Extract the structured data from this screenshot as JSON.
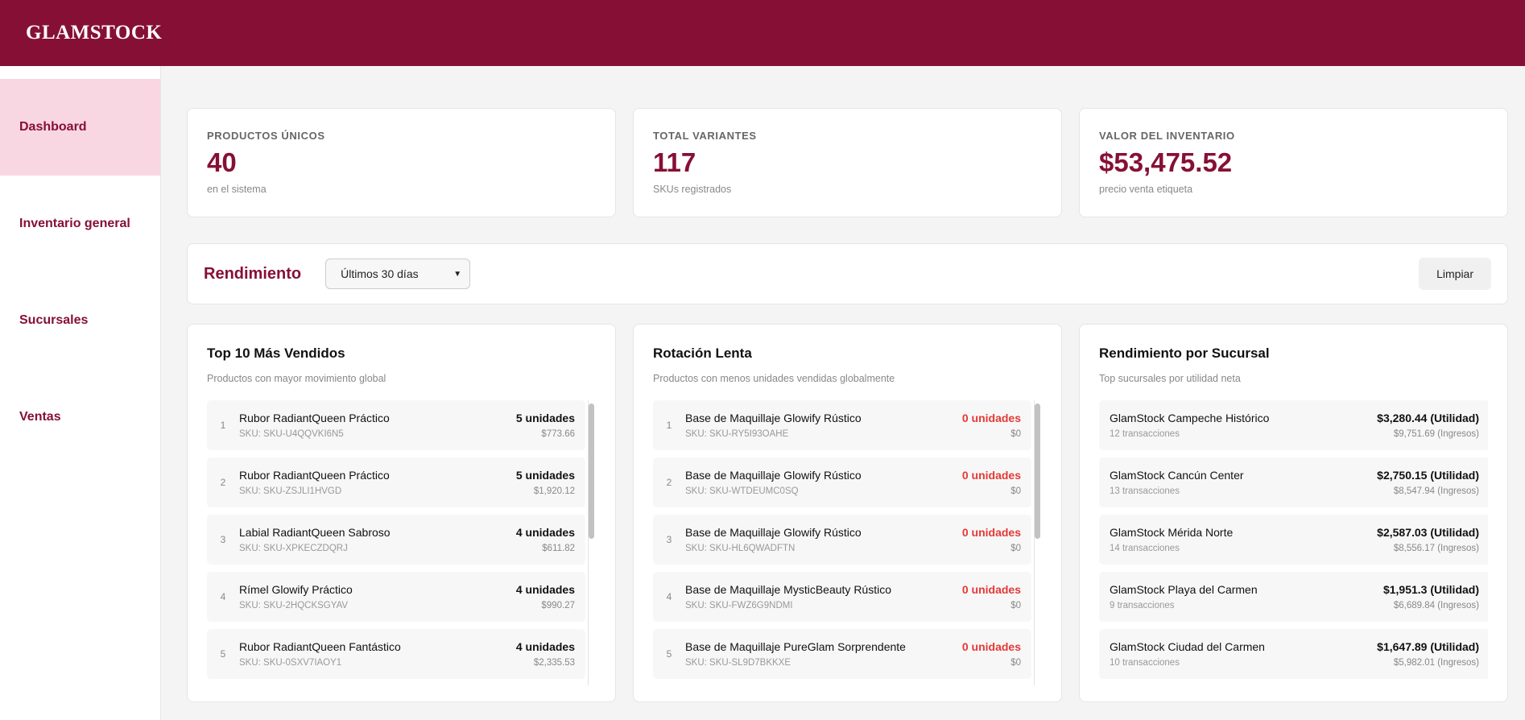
{
  "app": {
    "brand": "GLAMSTOCK"
  },
  "sidebar": {
    "items": [
      {
        "label": "Dashboard",
        "active": true
      },
      {
        "label": "Inventario general"
      },
      {
        "label": "Sucursales"
      },
      {
        "label": "Ventas"
      }
    ]
  },
  "stats": [
    {
      "label": "PRODUCTOS ÚNICOS",
      "value": "40",
      "sub": "en el sistema"
    },
    {
      "label": "TOTAL VARIANTES",
      "value": "117",
      "sub": "SKUs registrados"
    },
    {
      "label": "VALOR DEL INVENTARIO",
      "value": "$53,475.52",
      "sub": "precio venta etiqueta"
    }
  ],
  "performance": {
    "title": "Rendimiento",
    "range_selected": "Últimos 30 días",
    "clear_label": "Limpiar"
  },
  "top_sellers": {
    "title": "Top 10 Más Vendidos",
    "subtitle": "Productos con mayor movimiento global",
    "items": [
      {
        "rank": "1",
        "name": "Rubor RadiantQueen Práctico",
        "sku": "SKU: SKU-U4QQVKI6N5",
        "units": "5 unidades",
        "amount": "$773.66"
      },
      {
        "rank": "2",
        "name": "Rubor RadiantQueen Práctico",
        "sku": "SKU: SKU-ZSJLI1HVGD",
        "units": "5 unidades",
        "amount": "$1,920.12"
      },
      {
        "rank": "3",
        "name": "Labial RadiantQueen Sabroso",
        "sku": "SKU: SKU-XPKECZDQRJ",
        "units": "4 unidades",
        "amount": "$611.82"
      },
      {
        "rank": "4",
        "name": "Rímel Glowify Práctico",
        "sku": "SKU: SKU-2HQCKSGYAV",
        "units": "4 unidades",
        "amount": "$990.27"
      },
      {
        "rank": "5",
        "name": "Rubor RadiantQueen Fantástico",
        "sku": "SKU: SKU-0SXV7IAOY1",
        "units": "4 unidades",
        "amount": "$2,335.53"
      }
    ]
  },
  "slow_rotation": {
    "title": "Rotación Lenta",
    "subtitle": "Productos con menos unidades vendidas globalmente",
    "items": [
      {
        "rank": "1",
        "name": "Base de Maquillaje Glowify Rústico",
        "sku": "SKU: SKU-RY5I93OAHE",
        "units": "0 unidades",
        "amount": "$0"
      },
      {
        "rank": "2",
        "name": "Base de Maquillaje Glowify Rústico",
        "sku": "SKU: SKU-WTDEUMC0SQ",
        "units": "0 unidades",
        "amount": "$0"
      },
      {
        "rank": "3",
        "name": "Base de Maquillaje Glowify Rústico",
        "sku": "SKU: SKU-HL6QWADFTN",
        "units": "0 unidades",
        "amount": "$0"
      },
      {
        "rank": "4",
        "name": "Base de Maquillaje MysticBeauty Rústico",
        "sku": "SKU: SKU-FWZ6G9NDMI",
        "units": "0 unidades",
        "amount": "$0"
      },
      {
        "rank": "5",
        "name": "Base de Maquillaje PureGlam Sorprendente",
        "sku": "SKU: SKU-SL9D7BKKXE",
        "units": "0 unidades",
        "amount": "$0"
      }
    ]
  },
  "branches": {
    "title": "Rendimiento por Sucursal",
    "subtitle": "Top sucursales por utilidad neta",
    "items": [
      {
        "name": "GlamStock Campeche Histórico",
        "tx": "12 transacciones",
        "profit": "$3,280.44 (Utilidad)",
        "revenue": "$9,751.69 (Ingresos)"
      },
      {
        "name": "GlamStock Cancún Center",
        "tx": "13 transacciones",
        "profit": "$2,750.15 (Utilidad)",
        "revenue": "$8,547.94 (Ingresos)"
      },
      {
        "name": "GlamStock Mérida Norte",
        "tx": "14 transacciones",
        "profit": "$2,587.03 (Utilidad)",
        "revenue": "$8,556.17 (Ingresos)"
      },
      {
        "name": "GlamStock Playa del Carmen",
        "tx": "9 transacciones",
        "profit": "$1,951.3 (Utilidad)",
        "revenue": "$6,689.84 (Ingresos)"
      },
      {
        "name": "GlamStock Ciudad del Carmen",
        "tx": "10 transacciones",
        "profit": "$1,647.89 (Utilidad)",
        "revenue": "$5,982.01 (Ingresos)"
      }
    ]
  },
  "colors": {
    "brand": "#861035",
    "active_nav": "#f9d7e2",
    "danger": "#e53935"
  }
}
